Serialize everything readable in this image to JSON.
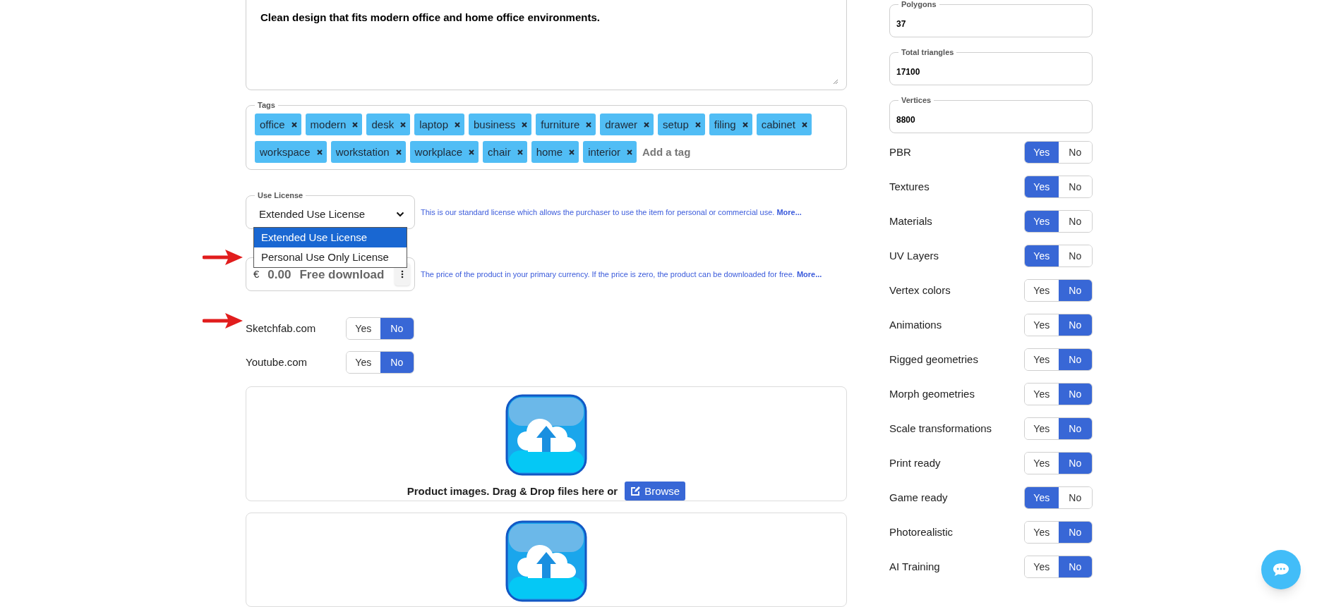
{
  "description": {
    "value": "Clean design that fits modern office and home office environments."
  },
  "tags": {
    "label": "Tags",
    "items": [
      "office",
      "modern",
      "desk",
      "laptop",
      "business",
      "furniture",
      "drawer",
      "setup",
      "filing",
      "cabinet",
      "workspace",
      "workstation",
      "workplace",
      "chair",
      "home",
      "interior"
    ],
    "placeholder": "Add a tag"
  },
  "license": {
    "label": "Use License",
    "value": "Extended Use License",
    "expanded": true,
    "options": [
      {
        "label": "Extended Use License",
        "selected": true
      },
      {
        "label": "Personal Use Only License",
        "selected": false
      }
    ],
    "hint": "This is our standard license which allows the purchaser to use the item for personal or commercial use.",
    "hint_link": "More..."
  },
  "price": {
    "currency": "€",
    "value": "0.00",
    "note": "Free download",
    "hint": "The price of the product in your primary currency. If the price is zero, the product can be downloaded for free.",
    "hint_link": "More..."
  },
  "platforms": [
    {
      "label": "Sketchfab.com",
      "options": [
        {
          "label": "Yes",
          "selected": false
        },
        {
          "label": "No",
          "selected": true
        }
      ]
    },
    {
      "label": "Youtube.com",
      "options": [
        {
          "label": "Yes",
          "selected": false
        },
        {
          "label": "No",
          "selected": true
        }
      ]
    }
  ],
  "upload_zones": [
    {
      "kind": "full",
      "text": "Product images. Drag & Drop files here or",
      "button": "Browse"
    },
    {
      "kind": "partial"
    }
  ],
  "stats": [
    {
      "label": "Polygons",
      "value": "37"
    },
    {
      "label": "Total triangles",
      "value": "17100"
    },
    {
      "label": "Vertices",
      "value": "8800"
    }
  ],
  "features": [
    {
      "label": "PBR",
      "options": [
        {
          "label": "Yes",
          "selected": true
        },
        {
          "label": "No",
          "selected": false
        }
      ]
    },
    {
      "label": "Textures",
      "options": [
        {
          "label": "Yes",
          "selected": true
        },
        {
          "label": "No",
          "selected": false
        }
      ]
    },
    {
      "label": "Materials",
      "options": [
        {
          "label": "Yes",
          "selected": true
        },
        {
          "label": "No",
          "selected": false
        }
      ]
    },
    {
      "label": "UV Layers",
      "options": [
        {
          "label": "Yes",
          "selected": true
        },
        {
          "label": "No",
          "selected": false
        }
      ]
    },
    {
      "label": "Vertex colors",
      "options": [
        {
          "label": "Yes",
          "selected": false
        },
        {
          "label": "No",
          "selected": true
        }
      ]
    },
    {
      "label": "Animations",
      "options": [
        {
          "label": "Yes",
          "selected": false
        },
        {
          "label": "No",
          "selected": true
        }
      ]
    },
    {
      "label": "Rigged geometries",
      "options": [
        {
          "label": "Yes",
          "selected": false
        },
        {
          "label": "No",
          "selected": true
        }
      ]
    },
    {
      "label": "Morph geometries",
      "options": [
        {
          "label": "Yes",
          "selected": false
        },
        {
          "label": "No",
          "selected": true
        }
      ]
    },
    {
      "label": "Scale transformations",
      "options": [
        {
          "label": "Yes",
          "selected": false
        },
        {
          "label": "No",
          "selected": true
        }
      ]
    },
    {
      "label": "Print ready",
      "options": [
        {
          "label": "Yes",
          "selected": false
        },
        {
          "label": "No",
          "selected": true
        }
      ]
    },
    {
      "label": "Game ready",
      "options": [
        {
          "label": "Yes",
          "selected": true
        },
        {
          "label": "No",
          "selected": false
        }
      ]
    },
    {
      "label": "Photorealistic",
      "options": [
        {
          "label": "Yes",
          "selected": false
        },
        {
          "label": "No",
          "selected": true
        }
      ]
    },
    {
      "label": "AI Training",
      "options": [
        {
          "label": "Yes",
          "selected": false
        },
        {
          "label": "No",
          "selected": true
        }
      ]
    }
  ]
}
